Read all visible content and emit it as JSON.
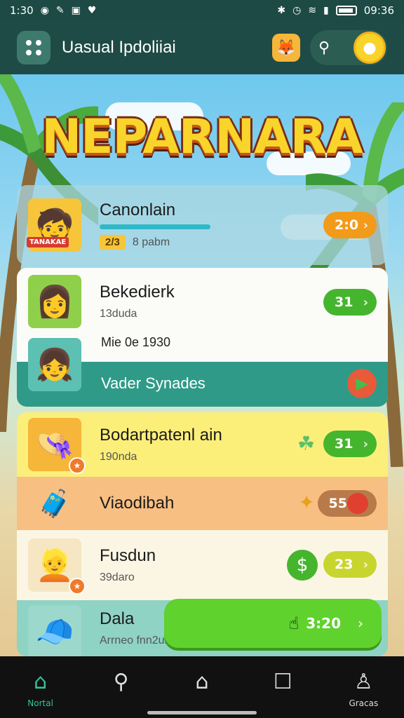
{
  "status_bar": {
    "time": "1:30",
    "clock": "09:36"
  },
  "app_bar": {
    "title": "Uasual Ipdoliiai"
  },
  "game_title": "NEPARNARA",
  "cards": [
    {
      "name": "Canonlain",
      "badge": "2/3",
      "sub": "8 pabm",
      "avatar_tag": "TANAKAE",
      "pill": "2:0",
      "pill_color": "#f29a1a"
    },
    {
      "name": "Bekedierk",
      "sub": "13duda",
      "pill": "31",
      "pill_color": "#45b52d"
    },
    {
      "name": "Mie 0e 1930"
    },
    {
      "name": "Vader Synades"
    },
    {
      "name": "Bodartpatenl ain",
      "sub": "190nda",
      "pill": "31",
      "pill_color": "#45b52d"
    },
    {
      "name": "Viaodibah",
      "pill": "55",
      "pill_color": "#d64535"
    },
    {
      "name": "Fusdun",
      "sub": "39daro",
      "pill": "23",
      "pill_color": "#b8c92a"
    },
    {
      "name": "Dala",
      "sub": "Arrneo fnn2ub",
      "cta": "3:20"
    }
  ],
  "nav": [
    {
      "label": "Nortal",
      "icon": "home-icon"
    },
    {
      "label": "",
      "icon": "search-icon"
    },
    {
      "label": "",
      "icon": "house-icon"
    },
    {
      "label": "",
      "icon": "square-icon"
    },
    {
      "label": "Gracas",
      "icon": "profile-icon"
    }
  ],
  "colors": {
    "accent": "#33c29a",
    "appbar": "#1e4b45",
    "teal_band": "#2f9a88",
    "yellow_card": "#fbef7a",
    "orange_band": "#f8bf83"
  }
}
